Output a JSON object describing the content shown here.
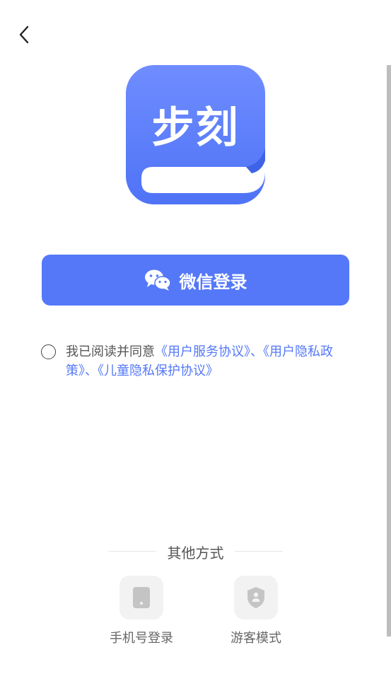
{
  "header": {
    "back_icon": "chevron-left-icon"
  },
  "logo": {
    "text": "步刻",
    "color": "#5478f8"
  },
  "wechat_login": {
    "label": "微信登录",
    "icon": "wechat-icon",
    "color": "#5478f8"
  },
  "agreement": {
    "prefix": "我已阅读并同意",
    "user_service": "《用户服务协议》",
    "sep1": "、",
    "privacy": "《用户隐私政策》",
    "sep2": "、",
    "child_privacy": "《儿童隐私保护协议》"
  },
  "other_methods": {
    "title": "其他方式",
    "options": [
      {
        "label": "手机号登录",
        "icon": "phone-icon"
      },
      {
        "label": "游客模式",
        "icon": "shield-user-icon"
      }
    ]
  }
}
